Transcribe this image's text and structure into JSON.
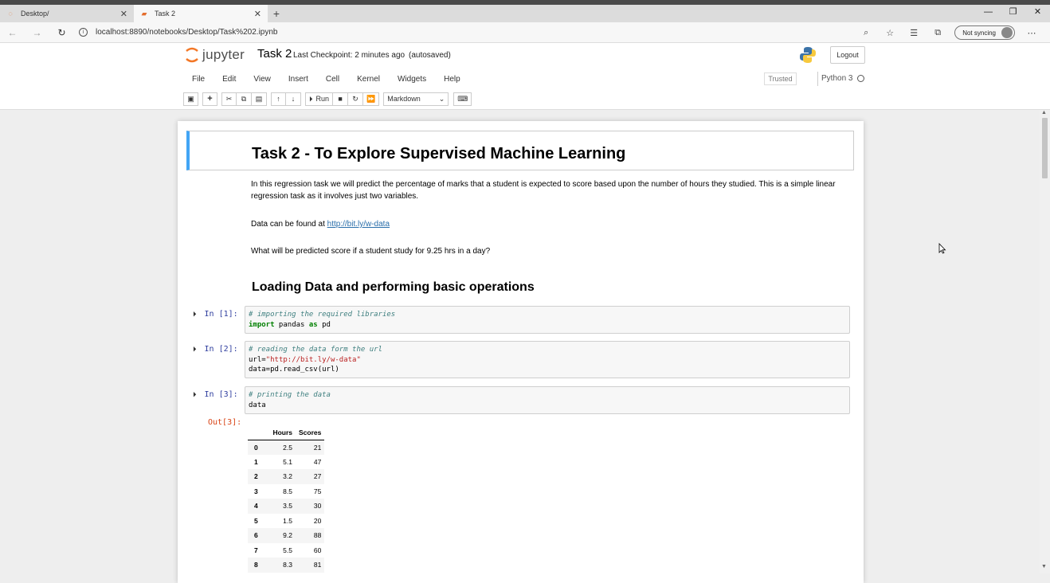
{
  "browser": {
    "tabs": [
      {
        "title": "Desktop/",
        "active": false
      },
      {
        "title": "Task 2",
        "active": true
      }
    ],
    "url": "localhost:8890/notebooks/Desktop/Task%202.ipynb",
    "sync_label": "Not syncing"
  },
  "jupyter": {
    "logo_text": "jupyter",
    "notebook_title": "Task 2",
    "checkpoint": "Last Checkpoint: 2 minutes ago",
    "autosaved": "(autosaved)",
    "logout_label": "Logout",
    "menu": [
      "File",
      "Edit",
      "View",
      "Insert",
      "Cell",
      "Kernel",
      "Widgets",
      "Help"
    ],
    "trusted_label": "Trusted",
    "kernel_name": "Python 3",
    "run_label": "Run",
    "cell_type": "Markdown"
  },
  "notebook": {
    "heading1": "Task 2 - To Explore Supervised Machine Learning",
    "intro": "In this regression task we will predict the percentage of marks that a student is expected to score based upon the number of hours they studied. This is a simple linear regression task as it involves just two variables.",
    "data_prefix": "Data can be found at",
    "data_link": "http://bit.ly/w-data",
    "question": "What will be predicted score if a student study for 9.25 hrs in a day?",
    "heading2": "Loading Data and performing basic operations",
    "cells": [
      {
        "prompt": "In [1]:",
        "comment": "# importing the required libraries",
        "kw1": "import",
        "mid": " pandas ",
        "kw2": "as",
        "tail": " pd"
      },
      {
        "prompt": "In [2]:",
        "comment": "# reading the data form the url",
        "url_prefix": "url=",
        "url_str": "\"http://bit.ly/w-data\"",
        "line3": "data=pd.read_csv(url)"
      },
      {
        "prompt": "In [3]:",
        "comment": "# printing the data",
        "line2": "data"
      }
    ],
    "output_prompt": "Out[3]:",
    "table": {
      "columns": [
        "Hours",
        "Scores"
      ],
      "rows": [
        [
          "0",
          "2.5",
          "21"
        ],
        [
          "1",
          "5.1",
          "47"
        ],
        [
          "2",
          "3.2",
          "27"
        ],
        [
          "3",
          "8.5",
          "75"
        ],
        [
          "4",
          "3.5",
          "30"
        ],
        [
          "5",
          "1.5",
          "20"
        ],
        [
          "6",
          "9.2",
          "88"
        ],
        [
          "7",
          "5.5",
          "60"
        ],
        [
          "8",
          "8.3",
          "81"
        ]
      ]
    }
  },
  "colors": {
    "selected_cell_border": "#42a5f5",
    "in_prompt": "#303f9f",
    "out_prompt": "#d84315",
    "link": "#296eaa"
  }
}
